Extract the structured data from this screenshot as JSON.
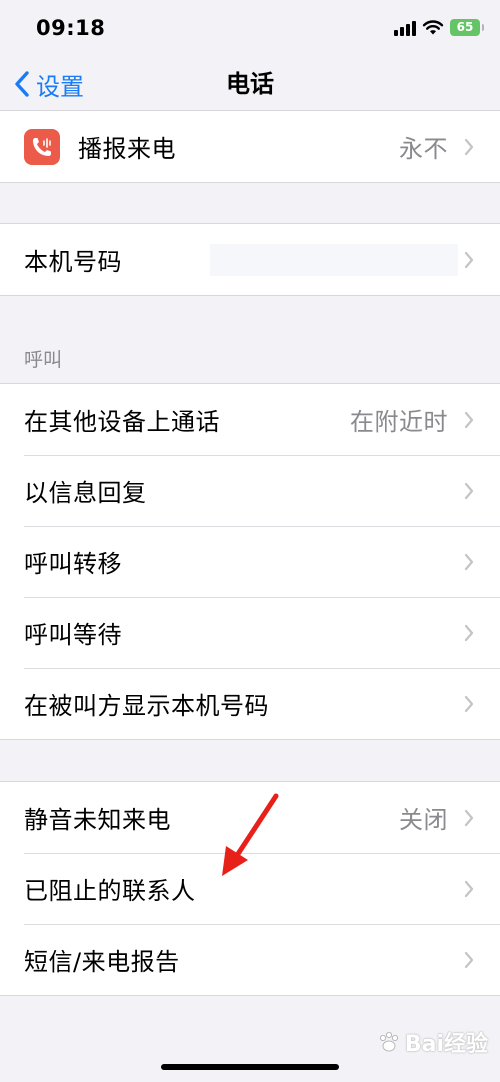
{
  "status_bar": {
    "time": "09:18",
    "battery": "65"
  },
  "nav": {
    "back_label": "设置",
    "title": "电话"
  },
  "announce_group": {
    "label": "播报来电",
    "value": "永不"
  },
  "my_number_group": {
    "label": "本机号码"
  },
  "calls_section": {
    "header": "呼叫",
    "items": [
      {
        "label": "在其他设备上通话",
        "value": "在附近时"
      },
      {
        "label": "以信息回复"
      },
      {
        "label": "呼叫转移"
      },
      {
        "label": "呼叫等待"
      },
      {
        "label": "在被叫方显示本机号码"
      }
    ]
  },
  "silence_group": {
    "items": [
      {
        "label": "静音未知来电",
        "value": "关闭"
      },
      {
        "label": "已阻止的联系人"
      },
      {
        "label": "短信/来电报告"
      }
    ]
  },
  "watermark": {
    "text": "Bai经验"
  },
  "colors": {
    "accent": "#1a7cf5",
    "app_icon": "#ec5a4a",
    "battery": "#65c466",
    "annotation_arrow": "#e8201a"
  },
  "icons": {
    "back": "chevron-left-icon",
    "row": "chevron-right-icon",
    "announce_app": "phone-wave-icon"
  }
}
